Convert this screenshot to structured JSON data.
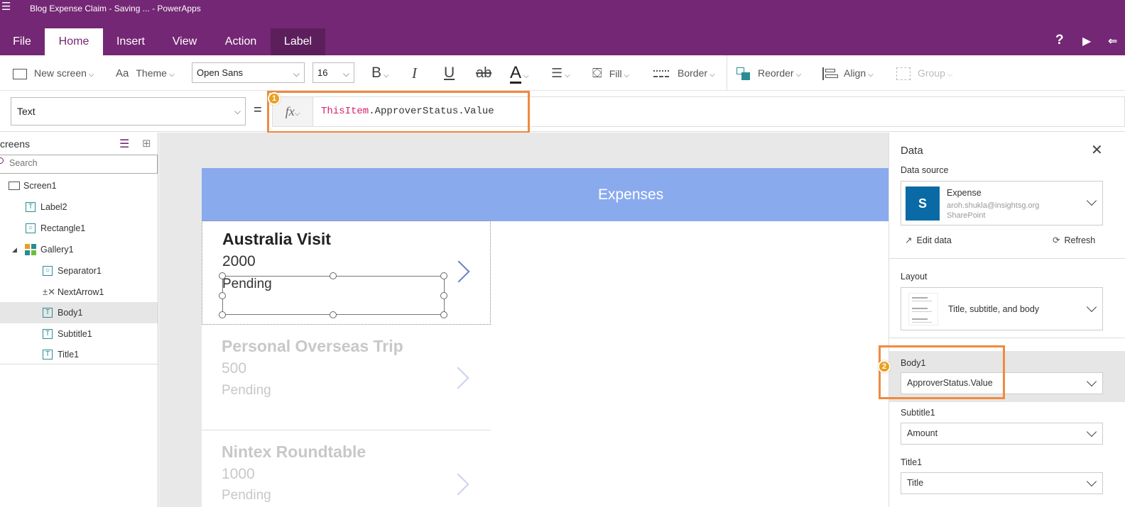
{
  "window": {
    "title": "Blog Expense Claim - Saving ... - PowerApps"
  },
  "ribbon_tabs": [
    "File",
    "Home",
    "Insert",
    "View",
    "Action",
    "Label"
  ],
  "toolbar": {
    "new_screen": "New screen",
    "theme": "Theme",
    "font": "Open Sans",
    "font_size": "16",
    "bold": "B",
    "italic": "I",
    "underline": "U",
    "strike": "ab",
    "font_color": "A",
    "fill": "Fill",
    "border": "Border",
    "reorder": "Reorder",
    "align": "Align",
    "group": "Group"
  },
  "formula_bar": {
    "property": "Text",
    "equals": "=",
    "fx": "fx",
    "formula_keyword": "ThisItem",
    "formula_rest": ".ApproverStatus.Value",
    "badge": "1"
  },
  "tree_panel": {
    "title": "creens",
    "search_placeholder": "Search",
    "items": [
      {
        "label": "Screen1",
        "icon": "screen-icon"
      },
      {
        "label": "Label2",
        "icon": "label-icon"
      },
      {
        "label": "Rectangle1",
        "icon": "shape-icon"
      },
      {
        "label": "Gallery1",
        "icon": "gallery-icon"
      },
      {
        "label": "Separator1",
        "icon": "shape-icon"
      },
      {
        "label": "NextArrow1",
        "icon": "arrow-icon"
      },
      {
        "label": "Body1",
        "icon": "label-icon"
      },
      {
        "label": "Subtitle1",
        "icon": "label-icon"
      },
      {
        "label": "Title1",
        "icon": "label-icon"
      }
    ]
  },
  "app_screen": {
    "header": "Expenses",
    "gallery": [
      {
        "title": "Australia Visit",
        "subtitle": "2000",
        "body": "Pending"
      },
      {
        "title": "Personal Overseas Trip",
        "subtitle": "500",
        "body": "Pending"
      },
      {
        "title": "Nintex Roundtable",
        "subtitle": "1000",
        "body": "Pending"
      }
    ]
  },
  "data_panel": {
    "title": "Data",
    "data_source_label": "Data source",
    "source_name": "Expense",
    "source_account": "aroh.shukla@insightsg.org",
    "source_type": "SharePoint",
    "edit_data": "Edit data",
    "refresh": "Refresh",
    "layout_label": "Layout",
    "layout_value": "Title, subtitle, and body",
    "body_label": "Body1",
    "body_value": "ApproverStatus.Value",
    "body_badge": "2",
    "subtitle_label": "Subtitle1",
    "subtitle_value": "Amount",
    "title_label": "Title1",
    "title_value": "Title"
  },
  "colors": {
    "brand": "#742774",
    "accent": "#f08a3e",
    "header": "#8aaaee"
  }
}
